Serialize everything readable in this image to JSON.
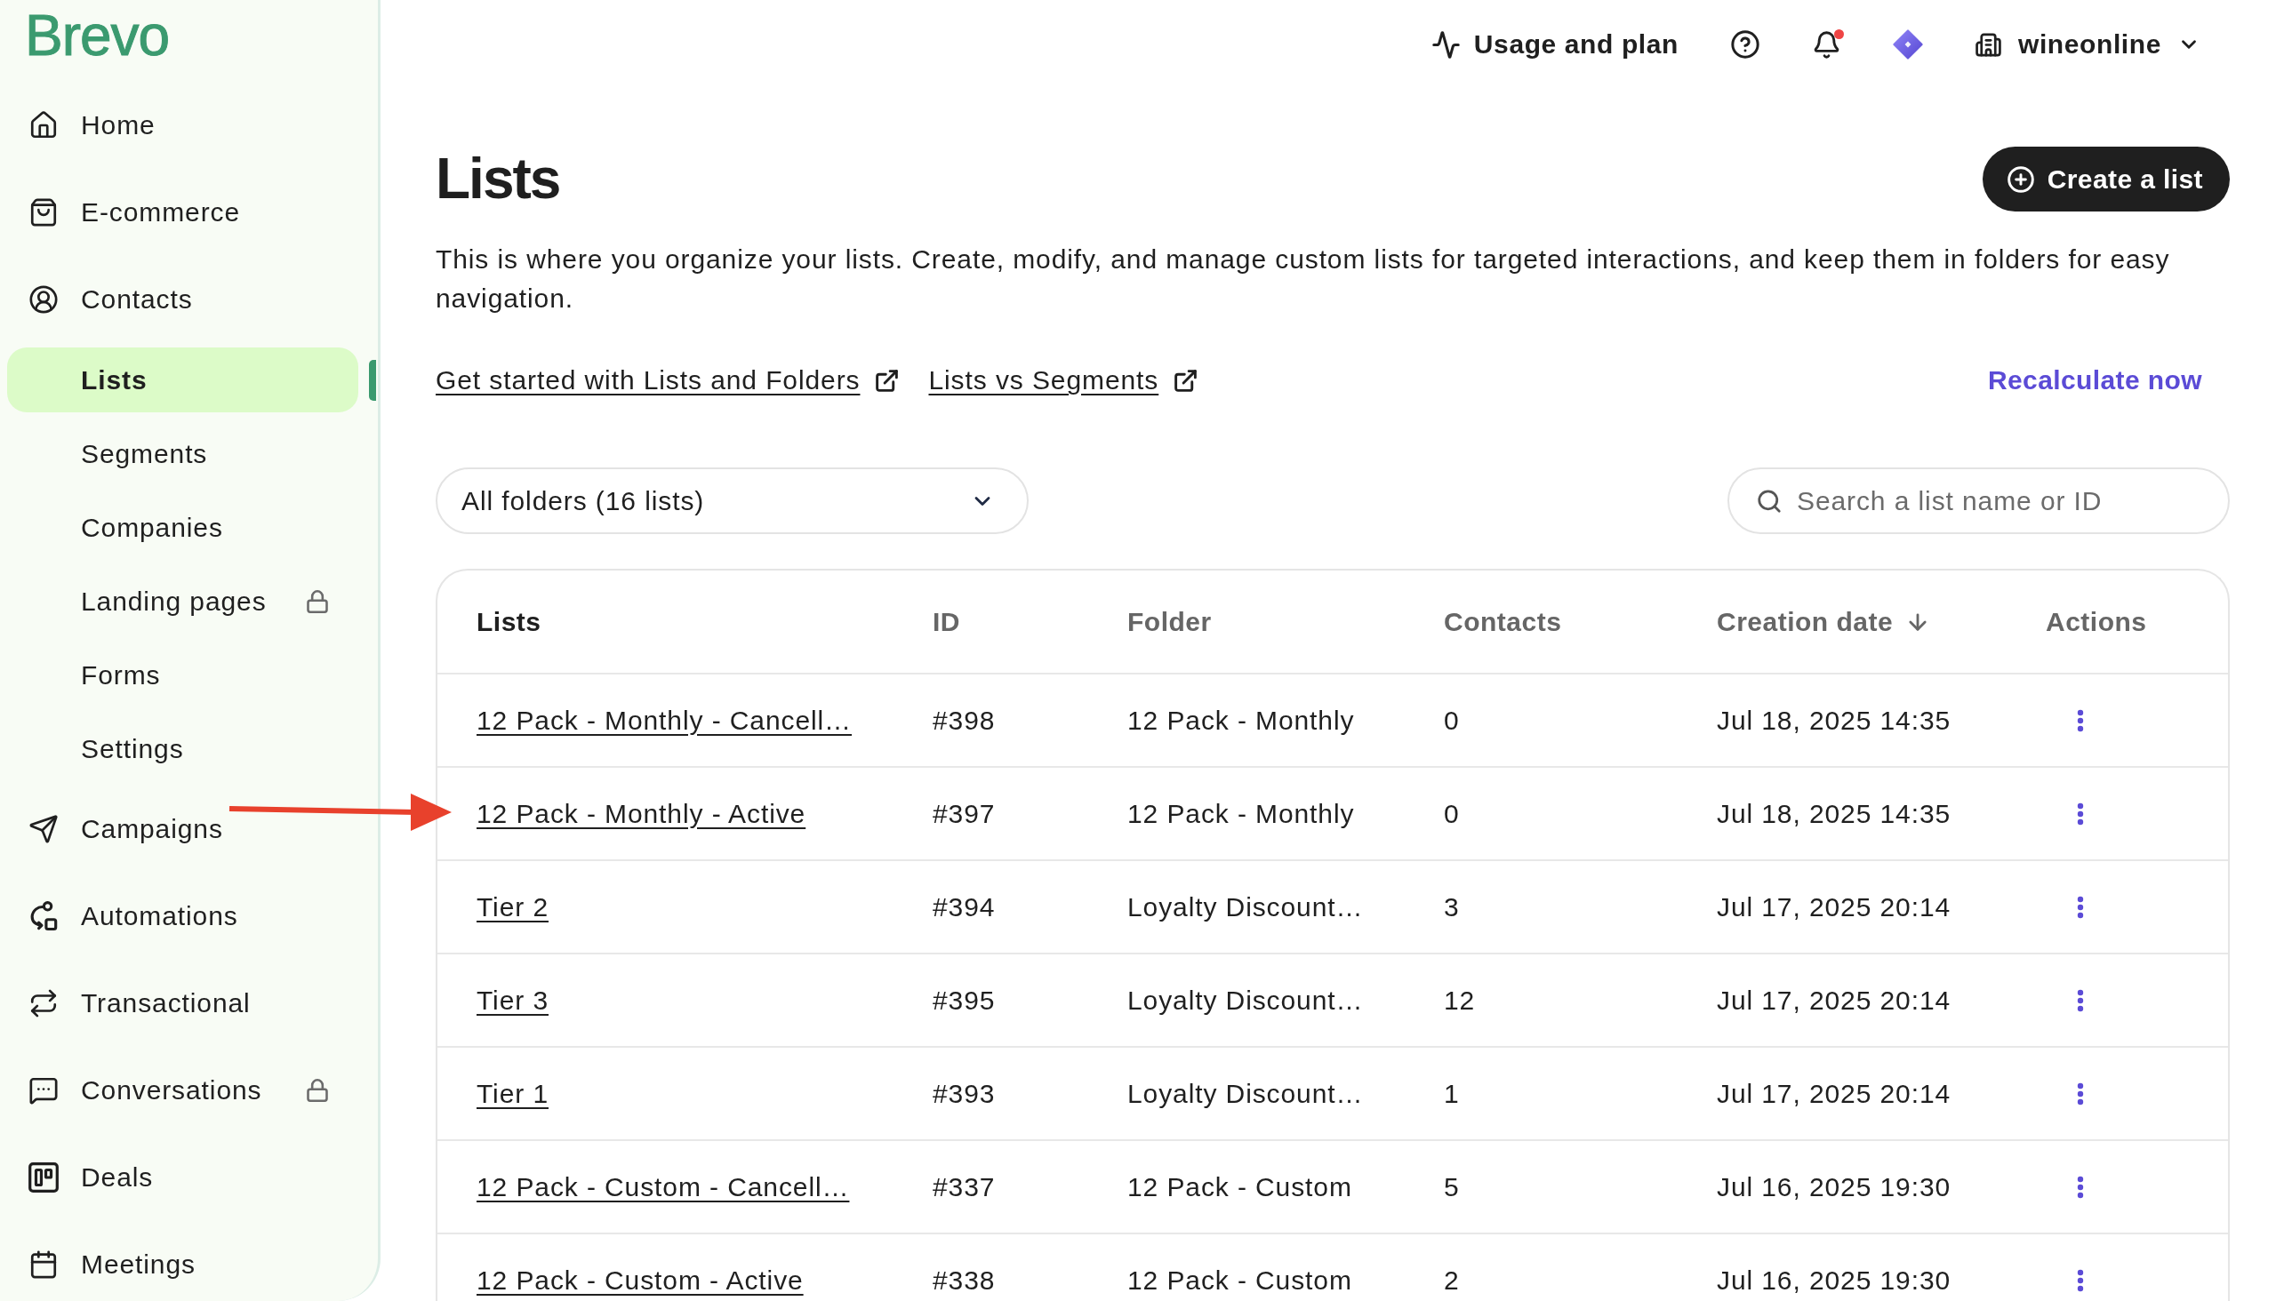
{
  "sidebar": {
    "logo": "Brevo",
    "items": [
      {
        "label": "Home",
        "selected": false,
        "locked": false
      },
      {
        "label": "E-commerce",
        "selected": false,
        "locked": false
      },
      {
        "label": "Contacts",
        "selected": false,
        "locked": false,
        "children": [
          {
            "label": "Lists",
            "selected": true,
            "locked": false
          },
          {
            "label": "Segments",
            "selected": false,
            "locked": false
          },
          {
            "label": "Companies",
            "selected": false,
            "locked": false
          },
          {
            "label": "Landing pages",
            "selected": false,
            "locked": true
          },
          {
            "label": "Forms",
            "selected": false,
            "locked": false
          },
          {
            "label": "Settings",
            "selected": false,
            "locked": false
          }
        ]
      },
      {
        "label": "Campaigns",
        "selected": false,
        "locked": false
      },
      {
        "label": "Automations",
        "selected": false,
        "locked": false
      },
      {
        "label": "Transactional",
        "selected": false,
        "locked": false
      },
      {
        "label": "Conversations",
        "selected": false,
        "locked": true
      },
      {
        "label": "Deals",
        "selected": false,
        "locked": false
      },
      {
        "label": "Meetings",
        "selected": false,
        "locked": false
      }
    ]
  },
  "topbar": {
    "usage": "Usage and plan",
    "unread_notifications": true,
    "account": "wineonline"
  },
  "header": {
    "title": "Lists",
    "create_button": "Create a list",
    "description": "This is where you organize your lists. Create, modify, and manage custom lists for targeted interactions, and keep them in folders for easy navigation.",
    "links": [
      {
        "label": "Get started with Lists and Folders",
        "external": true
      },
      {
        "label": "Lists vs Segments",
        "external": true
      }
    ],
    "recalculate_link": "Recalculate now"
  },
  "filters": {
    "folder_select": {
      "value": "All folders (16 lists)"
    },
    "search": {
      "placeholder": "Search a list name or ID"
    }
  },
  "table": {
    "columns": [
      {
        "label": "Lists",
        "sorted": false
      },
      {
        "label": "ID",
        "sorted": false
      },
      {
        "label": "Folder",
        "sorted": false
      },
      {
        "label": "Contacts",
        "sorted": false
      },
      {
        "label": "Creation date",
        "sorted": true
      },
      {
        "label": "Actions",
        "sorted": false
      }
    ],
    "rows": [
      {
        "name": "12 Pack - Monthly - Cancell…",
        "id": "#398",
        "folder": "12 Pack - Monthly",
        "contacts": "0",
        "created": "Jul 18, 2025 14:35"
      },
      {
        "name": "12 Pack - Monthly - Active",
        "id": "#397",
        "folder": "12 Pack - Monthly",
        "contacts": "0",
        "created": "Jul 18, 2025 14:35"
      },
      {
        "name": "Tier 2",
        "id": "#394",
        "folder": "Loyalty Discount…",
        "contacts": "3",
        "created": "Jul 17, 2025 20:14"
      },
      {
        "name": "Tier 3",
        "id": "#395",
        "folder": "Loyalty Discount…",
        "contacts": "12",
        "created": "Jul 17, 2025 20:14"
      },
      {
        "name": "Tier 1",
        "id": "#393",
        "folder": "Loyalty Discount…",
        "contacts": "1",
        "created": "Jul 17, 2025 20:14"
      },
      {
        "name": "12 Pack - Custom - Cancell…",
        "id": "#337",
        "folder": "12 Pack - Custom",
        "contacts": "5",
        "created": "Jul 16, 2025 19:30"
      },
      {
        "name": "12 Pack - Custom - Active",
        "id": "#338",
        "folder": "12 Pack - Custom",
        "contacts": "2",
        "created": "Jul 16, 2025 19:30"
      }
    ]
  }
}
